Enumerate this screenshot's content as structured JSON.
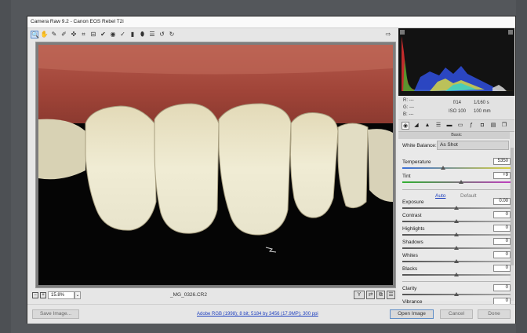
{
  "window": {
    "title": "Camera Raw 9.2  -  Canon EOS Rebel T2i"
  },
  "tools": [
    {
      "icon": "zoom-icon",
      "glyph": "🔍",
      "active": true
    },
    {
      "icon": "hand-icon",
      "glyph": "✋"
    },
    {
      "icon": "white-balance-icon",
      "glyph": "✎"
    },
    {
      "icon": "color-sampler-icon",
      "glyph": "✐"
    },
    {
      "icon": "targeted-adjustment-icon",
      "glyph": "✜"
    },
    {
      "icon": "crop-icon",
      "glyph": "⌗"
    },
    {
      "icon": "straighten-icon",
      "glyph": "⊟"
    },
    {
      "icon": "spot-removal-icon",
      "glyph": "✔"
    },
    {
      "icon": "red-eye-icon",
      "glyph": "◉"
    },
    {
      "icon": "adjustment-brush-icon",
      "glyph": "✓"
    },
    {
      "icon": "graduated-filter-icon",
      "glyph": "▮"
    },
    {
      "icon": "radial-filter-icon",
      "glyph": "⬮"
    },
    {
      "icon": "preferences-icon",
      "glyph": "☰"
    },
    {
      "icon": "rotate-ccw-icon",
      "glyph": "↺"
    },
    {
      "icon": "rotate-cw-icon",
      "glyph": "↻"
    }
  ],
  "bottombar": {
    "zoom": "15.8%",
    "filename": "_MG_0326.CR2"
  },
  "info": {
    "r": "R:   ---",
    "g": "G:   ---",
    "b": "B:   ---",
    "aperture": "f/14",
    "shutter": "1/160 s",
    "iso": "ISO 100",
    "focal": "100 mm"
  },
  "panel_tabs": [
    {
      "icon": "basic-icon",
      "glyph": "◉",
      "active": true
    },
    {
      "icon": "tone-curve-icon",
      "glyph": "◢"
    },
    {
      "icon": "detail-icon",
      "glyph": "▲"
    },
    {
      "icon": "hsl-icon",
      "glyph": "☰"
    },
    {
      "icon": "split-toning-icon",
      "glyph": "▬"
    },
    {
      "icon": "lens-corrections-icon",
      "glyph": "▭"
    },
    {
      "icon": "effects-icon",
      "glyph": "ƒ"
    },
    {
      "icon": "camera-calibration-icon",
      "glyph": "◘"
    },
    {
      "icon": "presets-icon",
      "glyph": "▤"
    },
    {
      "icon": "snapshots-icon",
      "glyph": "❐"
    }
  ],
  "basic": {
    "title": "Basic",
    "wb_label": "White Balance:",
    "wb_value": "As Shot",
    "auto": "Auto",
    "default": "Default",
    "sliders": [
      {
        "key": "temperature",
        "label": "Temperature",
        "value": "5350",
        "pos": 0.38,
        "track": "temp"
      },
      {
        "key": "tint",
        "label": "Tint",
        "value": "+9",
        "pos": 0.54,
        "track": "tint"
      },
      {
        "key": "exposure",
        "label": "Exposure",
        "value": "0.00",
        "pos": 0.5,
        "track": "gray"
      },
      {
        "key": "contrast",
        "label": "Contrast",
        "value": "0",
        "pos": 0.5,
        "track": "gray"
      },
      {
        "key": "highlights",
        "label": "Highlights",
        "value": "0",
        "pos": 0.5,
        "track": "gray"
      },
      {
        "key": "shadows",
        "label": "Shadows",
        "value": "0",
        "pos": 0.5,
        "track": "gray"
      },
      {
        "key": "whites",
        "label": "Whites",
        "value": "0",
        "pos": 0.5,
        "track": "gray"
      },
      {
        "key": "blacks",
        "label": "Blacks",
        "value": "0",
        "pos": 0.5,
        "track": "gray"
      },
      {
        "key": "clarity",
        "label": "Clarity",
        "value": "0",
        "pos": 0.5,
        "track": "gray"
      },
      {
        "key": "vibrance",
        "label": "Vibrance",
        "value": "0",
        "pos": 0.5,
        "track": "vib"
      }
    ]
  },
  "footer": {
    "save": "Save Image...",
    "workflow": "Adobe RGB (1998); 8 bit; 5184 by 3456 (17.9MP); 300 ppi",
    "open": "Open Image",
    "cancel": "Cancel",
    "done": "Done"
  },
  "colors": {
    "accent": "#5f8ec7",
    "link": "#1d3fbf",
    "gums": "#a85044",
    "teeth": "#ebe8d0"
  }
}
